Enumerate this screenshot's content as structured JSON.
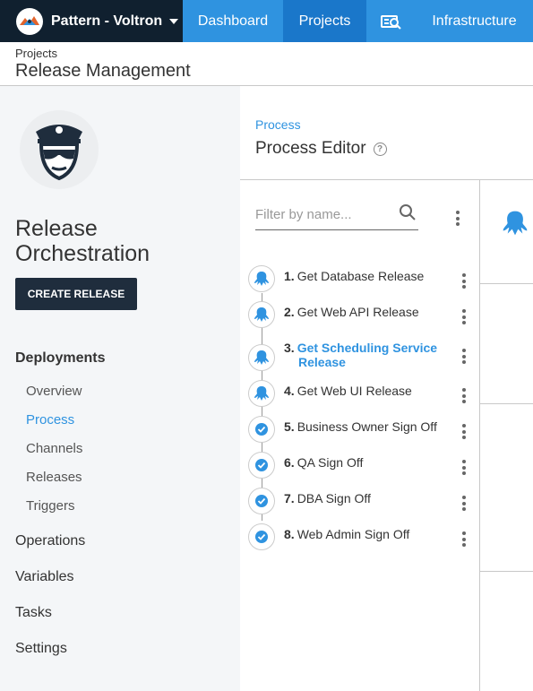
{
  "nav": {
    "space_name": "Pattern - Voltron",
    "items": [
      {
        "label": "Dashboard"
      },
      {
        "label": "Projects"
      },
      {
        "label": "",
        "icon": "search-machines-icon"
      },
      {
        "label": "Infrastructure"
      }
    ]
  },
  "header": {
    "crumb": "Projects",
    "title": "Release Management"
  },
  "sidebar": {
    "project_name": "Release Orchestration",
    "create_release": "CREATE RELEASE",
    "deployments_label": "Deployments",
    "deployment_items": [
      {
        "label": "Overview"
      },
      {
        "label": "Process"
      },
      {
        "label": "Channels"
      },
      {
        "label": "Releases"
      },
      {
        "label": "Triggers"
      }
    ],
    "groups": [
      {
        "label": "Operations"
      },
      {
        "label": "Variables"
      },
      {
        "label": "Tasks"
      },
      {
        "label": "Settings"
      }
    ]
  },
  "main": {
    "crumb": "Process",
    "title": "Process Editor",
    "filter_placeholder": "Filter by name...",
    "steps": [
      {
        "num": "1.",
        "name": "Get Database Release",
        "icon": "octopus-icon"
      },
      {
        "num": "2.",
        "name": "Get Web API Release",
        "icon": "octopus-icon"
      },
      {
        "num": "3.",
        "name": "Get Scheduling Service Release",
        "icon": "octopus-icon",
        "active": true
      },
      {
        "num": "4.",
        "name": "Get Web UI Release",
        "icon": "octopus-icon"
      },
      {
        "num": "5.",
        "name": "Business Owner Sign Off",
        "icon": "check-icon"
      },
      {
        "num": "6.",
        "name": "QA Sign Off",
        "icon": "check-icon"
      },
      {
        "num": "7.",
        "name": "DBA Sign Off",
        "icon": "check-icon"
      },
      {
        "num": "8.",
        "name": "Web Admin Sign Off",
        "icon": "check-icon"
      }
    ]
  },
  "colors": {
    "nav_dark": "#1f2d3d",
    "nav_blue": "#2f93e0",
    "nav_active": "#1a77ca",
    "accent": "#2f93e0"
  }
}
